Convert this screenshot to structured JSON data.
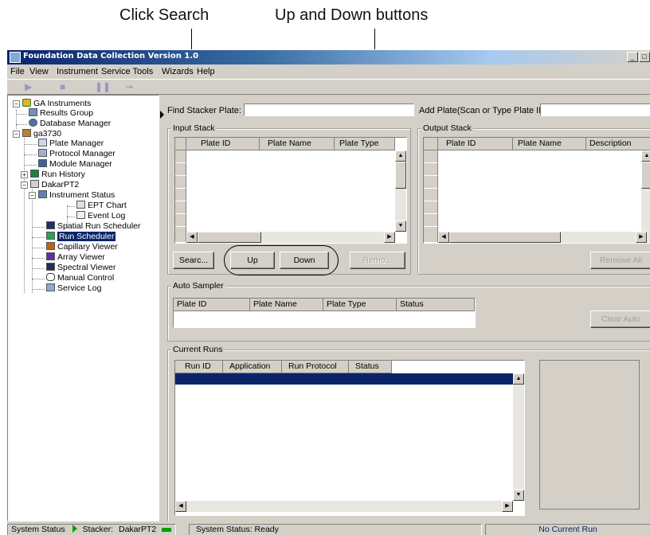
{
  "annotations": {
    "search_callout": "Click Search",
    "updown_callout": "Up and Down buttons"
  },
  "window": {
    "title": "Foundation Data Collection Version 1.0",
    "controls": [
      "_",
      "□",
      "×"
    ]
  },
  "menu": [
    "File",
    "View",
    "Instrument",
    "Service Tools",
    "Wizards",
    "Help"
  ],
  "toolbar": {
    "icons": [
      "play-icon",
      "stop-icon",
      "pause-icon",
      "skip-icon"
    ],
    "accent": "#9a98c8"
  },
  "tree": {
    "root": "GA Instruments",
    "results_group": "Results Group",
    "database_manager": "Database Manager",
    "instrument": "ga3730",
    "plate_manager": "Plate Manager",
    "protocol_manager": "Protocol Manager",
    "module_manager": "Module Manager",
    "run_history": "Run History",
    "dakar": "DakarPT2",
    "instrument_status": "Instrument Status",
    "ept_chart": "EPT Chart",
    "event_log": "Event Log",
    "spatial_run_scheduler": "Spatial Run Scheduler",
    "run_scheduler": "Run Scheduler",
    "capillary_viewer": "Capillary Viewer",
    "array_viewer": "Array Viewer",
    "spectral_viewer": "Spectral Viewer",
    "manual_control": "Manual Control",
    "service_log": "Service Log"
  },
  "find_stacker": {
    "label": "Find Stacker Plate:",
    "value": ""
  },
  "add_plate": {
    "label": "Add Plate(Scan or Type Plate ID):",
    "value": ""
  },
  "input_stack": {
    "title": "Input Stack",
    "columns": [
      "Plate ID",
      "Plate Name",
      "Plate Type"
    ],
    "buttons": {
      "search": "Searc...",
      "up": "Up",
      "down": "Down",
      "remove": "Remo..."
    }
  },
  "output_stack": {
    "title": "Output Stack",
    "columns": [
      "Plate ID",
      "Plate Name",
      "Description"
    ],
    "buttons": {
      "remove_all": "Remove All"
    }
  },
  "auto_sampler": {
    "title": "Auto Sampler",
    "columns": [
      "Plate ID",
      "Plate Name",
      "Plate Type",
      "Status"
    ],
    "buttons": {
      "clear_auto": "Clear Auto"
    }
  },
  "current_runs": {
    "title": "Current Runs",
    "columns": [
      "Run ID",
      "Application",
      "Run Protocol",
      "Status"
    ],
    "selection_color": "#0a246a"
  },
  "status_bar": {
    "system_status_label": "System Status",
    "stacker_label": "Stacker:",
    "stacker_value": "DakarPT2",
    "status_text": "System Status: Ready",
    "current_run": "No Current Run",
    "ok_color": "#00a000"
  }
}
